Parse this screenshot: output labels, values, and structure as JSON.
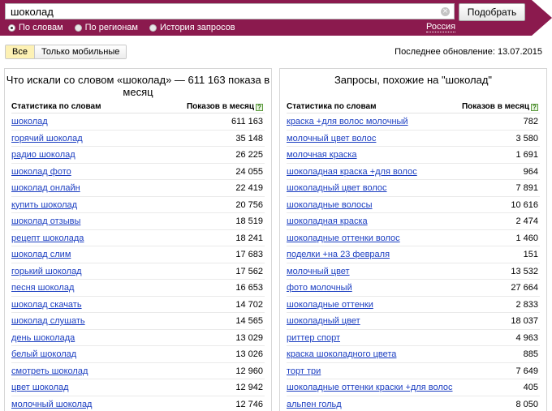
{
  "search": {
    "value": "шоколад",
    "submit_label": "Подобрать",
    "clear_glyph": "×"
  },
  "modes": [
    {
      "label": "По словам",
      "selected": true
    },
    {
      "label": "По регионам",
      "selected": false
    },
    {
      "label": "История запросов",
      "selected": false
    }
  ],
  "region": "Россия",
  "filters": {
    "all_label": "Все",
    "mobile_label": "Только мобильные"
  },
  "last_update": "Последнее обновление: 13.07.2015",
  "left": {
    "title": "Что искали со словом «шоколад» — 611 163 показа в месяц",
    "col_keyword": "Статистика по словам",
    "col_count": "Показов в месяц",
    "help": "?",
    "rows": [
      {
        "kw": "шоколад",
        "n": "611 163"
      },
      {
        "kw": "горячий шоколад",
        "n": "35 148"
      },
      {
        "kw": "радио шоколад",
        "n": "26 225"
      },
      {
        "kw": "шоколад фото",
        "n": "24 055"
      },
      {
        "kw": "шоколад онлайн",
        "n": "22 419"
      },
      {
        "kw": "купить шоколад",
        "n": "20 756"
      },
      {
        "kw": "шоколад отзывы",
        "n": "18 519"
      },
      {
        "kw": "рецепт шоколада",
        "n": "18 241"
      },
      {
        "kw": "шоколад слим",
        "n": "17 683"
      },
      {
        "kw": "горький шоколад",
        "n": "17 562"
      },
      {
        "kw": "песня шоколад",
        "n": "16 653"
      },
      {
        "kw": "шоколад скачать",
        "n": "14 702"
      },
      {
        "kw": "шоколад слушать",
        "n": "14 565"
      },
      {
        "kw": "день шоколада",
        "n": "13 029"
      },
      {
        "kw": "белый шоколад",
        "n": "13 026"
      },
      {
        "kw": "смотреть шоколад",
        "n": "12 960"
      },
      {
        "kw": "цвет шоколад",
        "n": "12 942"
      },
      {
        "kw": "молочный шоколад",
        "n": "12 746"
      }
    ]
  },
  "right": {
    "title": "Запросы, похожие на \"шоколад\"",
    "col_keyword": "Статистика по словам",
    "col_count": "Показов в месяц",
    "help": "?",
    "rows": [
      {
        "kw": "краска +для волос молочный",
        "n": "782"
      },
      {
        "kw": "молочный цвет волос",
        "n": "3 580"
      },
      {
        "kw": "молочная краска",
        "n": "1 691"
      },
      {
        "kw": "шоколадная краска +для волос",
        "n": "964"
      },
      {
        "kw": "шоколадный цвет волос",
        "n": "7 891"
      },
      {
        "kw": "шоколадные волосы",
        "n": "10 616"
      },
      {
        "kw": "шоколадная краска",
        "n": "2 474"
      },
      {
        "kw": "шоколадные оттенки волос",
        "n": "1 460"
      },
      {
        "kw": "поделки +на 23 февраля",
        "n": "151"
      },
      {
        "kw": "молочный цвет",
        "n": "13 532"
      },
      {
        "kw": "фото молочный",
        "n": "27 664"
      },
      {
        "kw": "шоколадные оттенки",
        "n": "2 833"
      },
      {
        "kw": "шоколадный цвет",
        "n": "18 037"
      },
      {
        "kw": "риттер спорт",
        "n": "4 963"
      },
      {
        "kw": "краска шоколадного цвета",
        "n": "885"
      },
      {
        "kw": "торт три",
        "n": "7 649"
      },
      {
        "kw": "шоколадные оттенки краски +для волос",
        "n": "405"
      },
      {
        "kw": "альпен гольд",
        "n": "8 050"
      }
    ]
  },
  "colors": {
    "header": "#8b1a4e",
    "link": "#1a3dc1",
    "active_tab": "#fdf1b4"
  }
}
